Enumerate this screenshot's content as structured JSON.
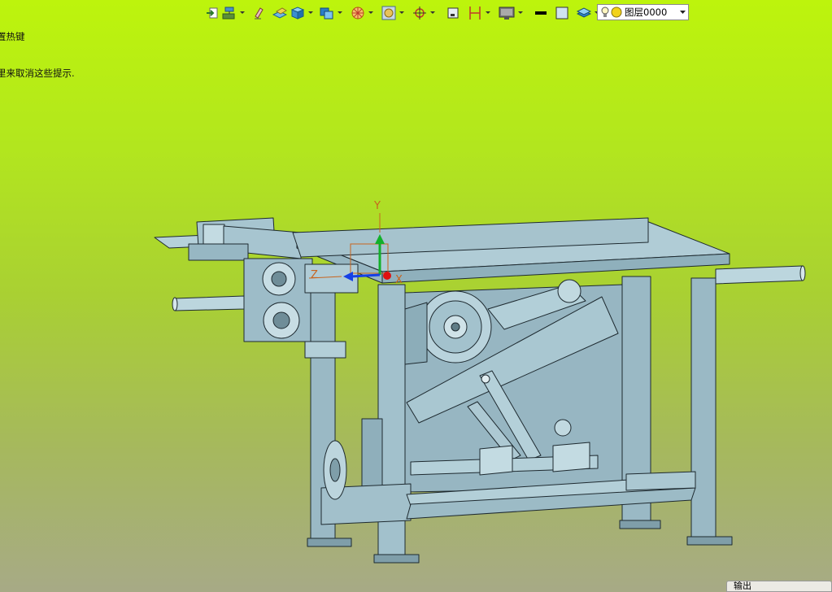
{
  "hint": {
    "line1": "置热键",
    "line2": "里来取消这些提示."
  },
  "toolbar": {
    "buttons": [
      {
        "icon": "import-icon",
        "dropdown": false
      },
      {
        "icon": "paint-roller-icon",
        "dropdown": true
      },
      {
        "icon": "eraser-icon",
        "dropdown": false
      },
      {
        "icon": "sheet-cube-icon",
        "dropdown": false
      },
      {
        "icon": "solid-cube-icon",
        "dropdown": true
      },
      {
        "icon": "copy-cube-icon",
        "dropdown": true
      },
      {
        "icon": "target-wheel-icon",
        "dropdown": true
      },
      {
        "icon": "frame-view-icon",
        "dropdown": true
      },
      {
        "icon": "snap-target-icon",
        "dropdown": true
      },
      {
        "icon": "small-box-icon",
        "dropdown": false
      },
      {
        "icon": "dimension-icon",
        "dropdown": true
      },
      {
        "icon": "monitor-icon",
        "dropdown": true
      },
      {
        "icon": "line-style-icon",
        "dropdown": false
      },
      {
        "icon": "color-swatch-icon",
        "dropdown": false
      },
      {
        "icon": "layers-icon",
        "dropdown": true
      }
    ]
  },
  "layer": {
    "name": "图层0000",
    "bulb_icon": "bulb-icon",
    "sun_icon": "sun-icon"
  },
  "axes": {
    "x": "X",
    "y": "Y",
    "z": "Z"
  },
  "output_tab": {
    "label": "输出"
  },
  "colors": {
    "background_top": "#bdf40c",
    "background_bottom": "#a7aa86",
    "model_fill": "#9fc0cc",
    "model_stroke": "#1e2a30"
  }
}
